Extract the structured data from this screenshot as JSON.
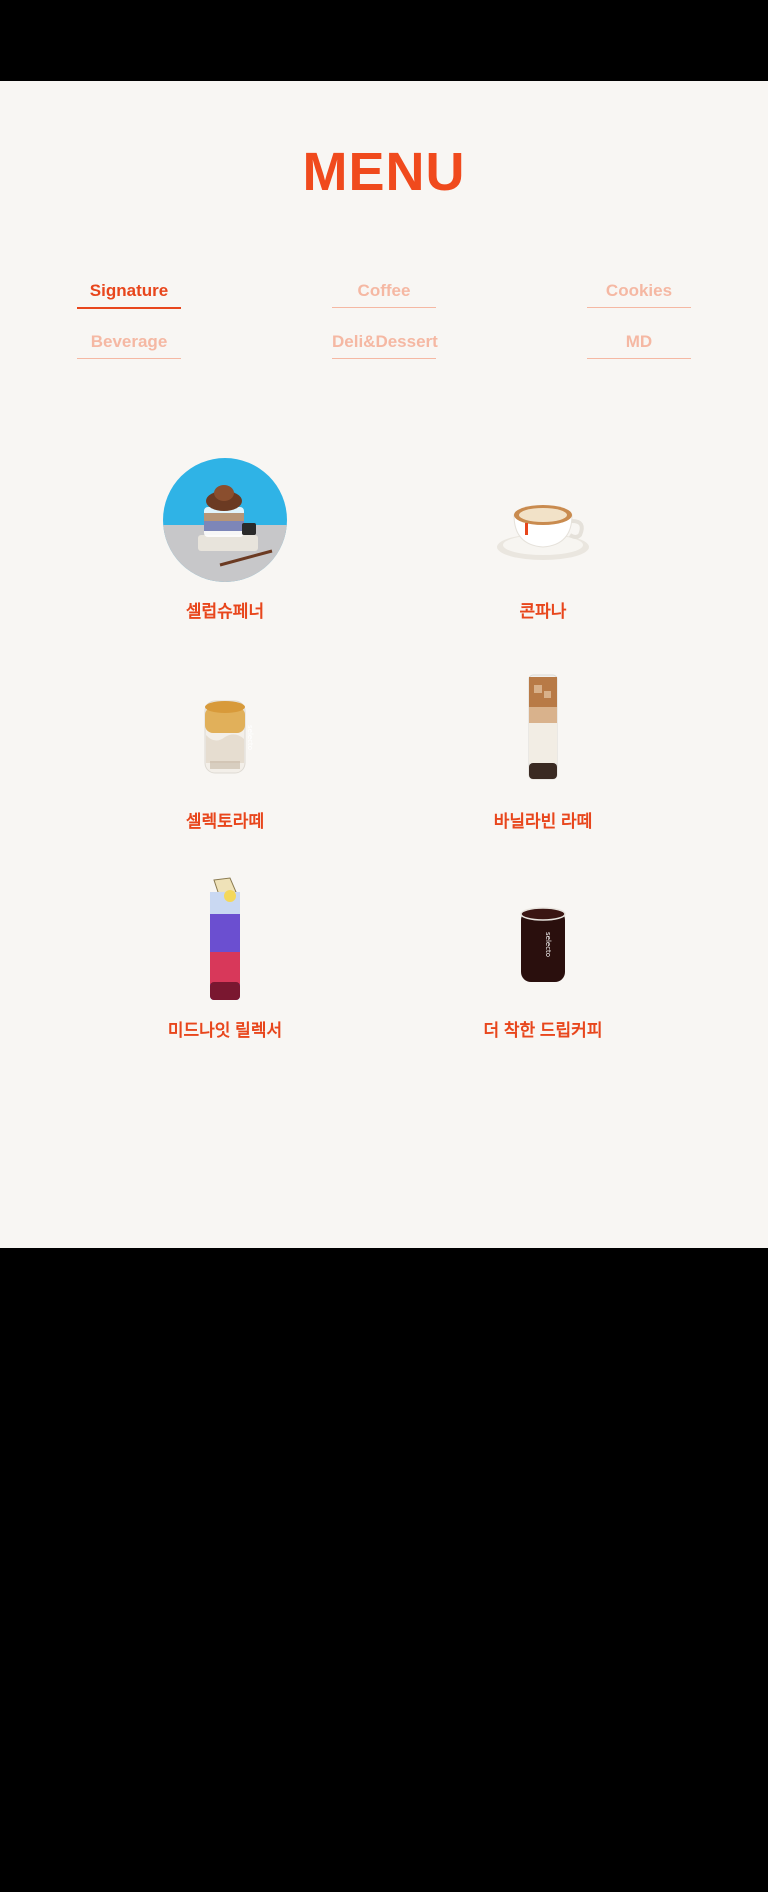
{
  "header": {
    "title": "MENU"
  },
  "tabs": [
    {
      "label": "Signature",
      "active": true
    },
    {
      "label": "Coffee",
      "active": false
    },
    {
      "label": "Cookies",
      "active": false
    },
    {
      "label": "Beverage",
      "active": false
    },
    {
      "label": "Deli&Dessert",
      "active": false
    },
    {
      "label": "MD",
      "active": false
    }
  ],
  "menu_items": [
    {
      "name": "셀럽슈페너",
      "image": "celeb-einspanner-image"
    },
    {
      "name": "콘파나",
      "image": "con-panna-image"
    },
    {
      "name": "셀렉토라떼",
      "image": "selecto-latte-image"
    },
    {
      "name": "바닐라빈 라떼",
      "image": "vanilla-bean-latte-image"
    },
    {
      "name": "미드나잇 릴렉서",
      "image": "midnight-relaxer-image"
    },
    {
      "name": "더 착한 드립커피",
      "image": "drip-coffee-image"
    }
  ],
  "colors": {
    "accent": "#e8461c",
    "inactive_tab": "#f5b8a3",
    "background": "#f8f6f3"
  }
}
